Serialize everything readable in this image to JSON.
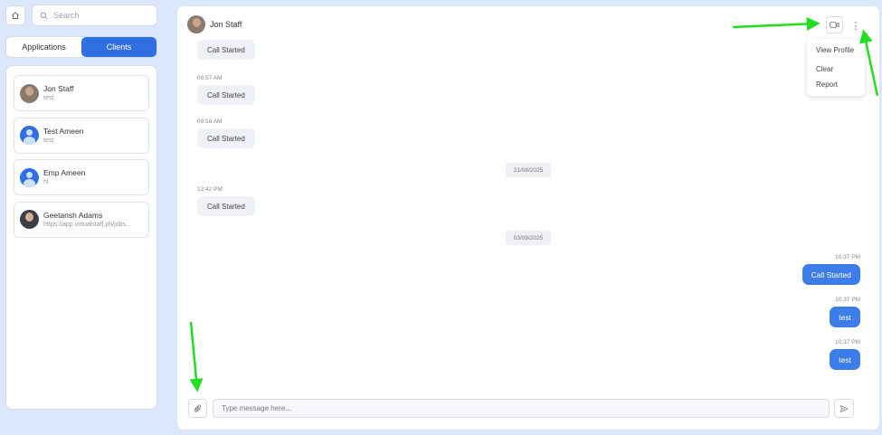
{
  "sidebar": {
    "search_placeholder": "Search",
    "tabs": [
      {
        "label": "Applications",
        "active": false
      },
      {
        "label": "Clients",
        "active": true
      }
    ],
    "contacts": [
      {
        "name": "Jon Staff",
        "preview": "test",
        "avatar": "photo"
      },
      {
        "name": "Test Ameen",
        "preview": "test",
        "avatar": "generic"
      },
      {
        "name": "Emp Ameen",
        "preview": "hi",
        "avatar": "generic"
      },
      {
        "name": "Geetansh Adams",
        "preview": "https://app.virtualstaff.ph/jobs...",
        "avatar": "photo"
      }
    ]
  },
  "chat": {
    "title": "Jon Staff",
    "menu": {
      "items": [
        "View Profile",
        "Clear",
        "Report"
      ]
    },
    "messages": [
      {
        "direction": "in",
        "time": "",
        "text": "Call Started"
      },
      {
        "direction": "in",
        "time": "09:57 AM",
        "text": "Call Started"
      },
      {
        "direction": "in",
        "time": "09:58 AM",
        "text": "Call Started"
      },
      {
        "type": "date",
        "text": "21/08/2025"
      },
      {
        "direction": "in",
        "time": "12:42 PM",
        "text": "Call Started"
      },
      {
        "type": "date",
        "text": "03/09/2025"
      },
      {
        "direction": "out",
        "time": "10:37 PM",
        "text": "Call Started"
      },
      {
        "direction": "out",
        "time": "10:37 PM",
        "text": "test"
      },
      {
        "direction": "out",
        "time": "10:37 PM",
        "text": "test"
      }
    ],
    "input_placeholder": "Type message here..."
  },
  "colors": {
    "accent": "#2f6fe0",
    "outgoing_bubble": "#3c7dea",
    "annotation_arrow": "#22dd22",
    "background": "#dbe7fb"
  },
  "icons": [
    "home-icon",
    "search-icon",
    "video-call-icon",
    "more-vertical-icon",
    "paperclip-icon",
    "send-icon"
  ]
}
